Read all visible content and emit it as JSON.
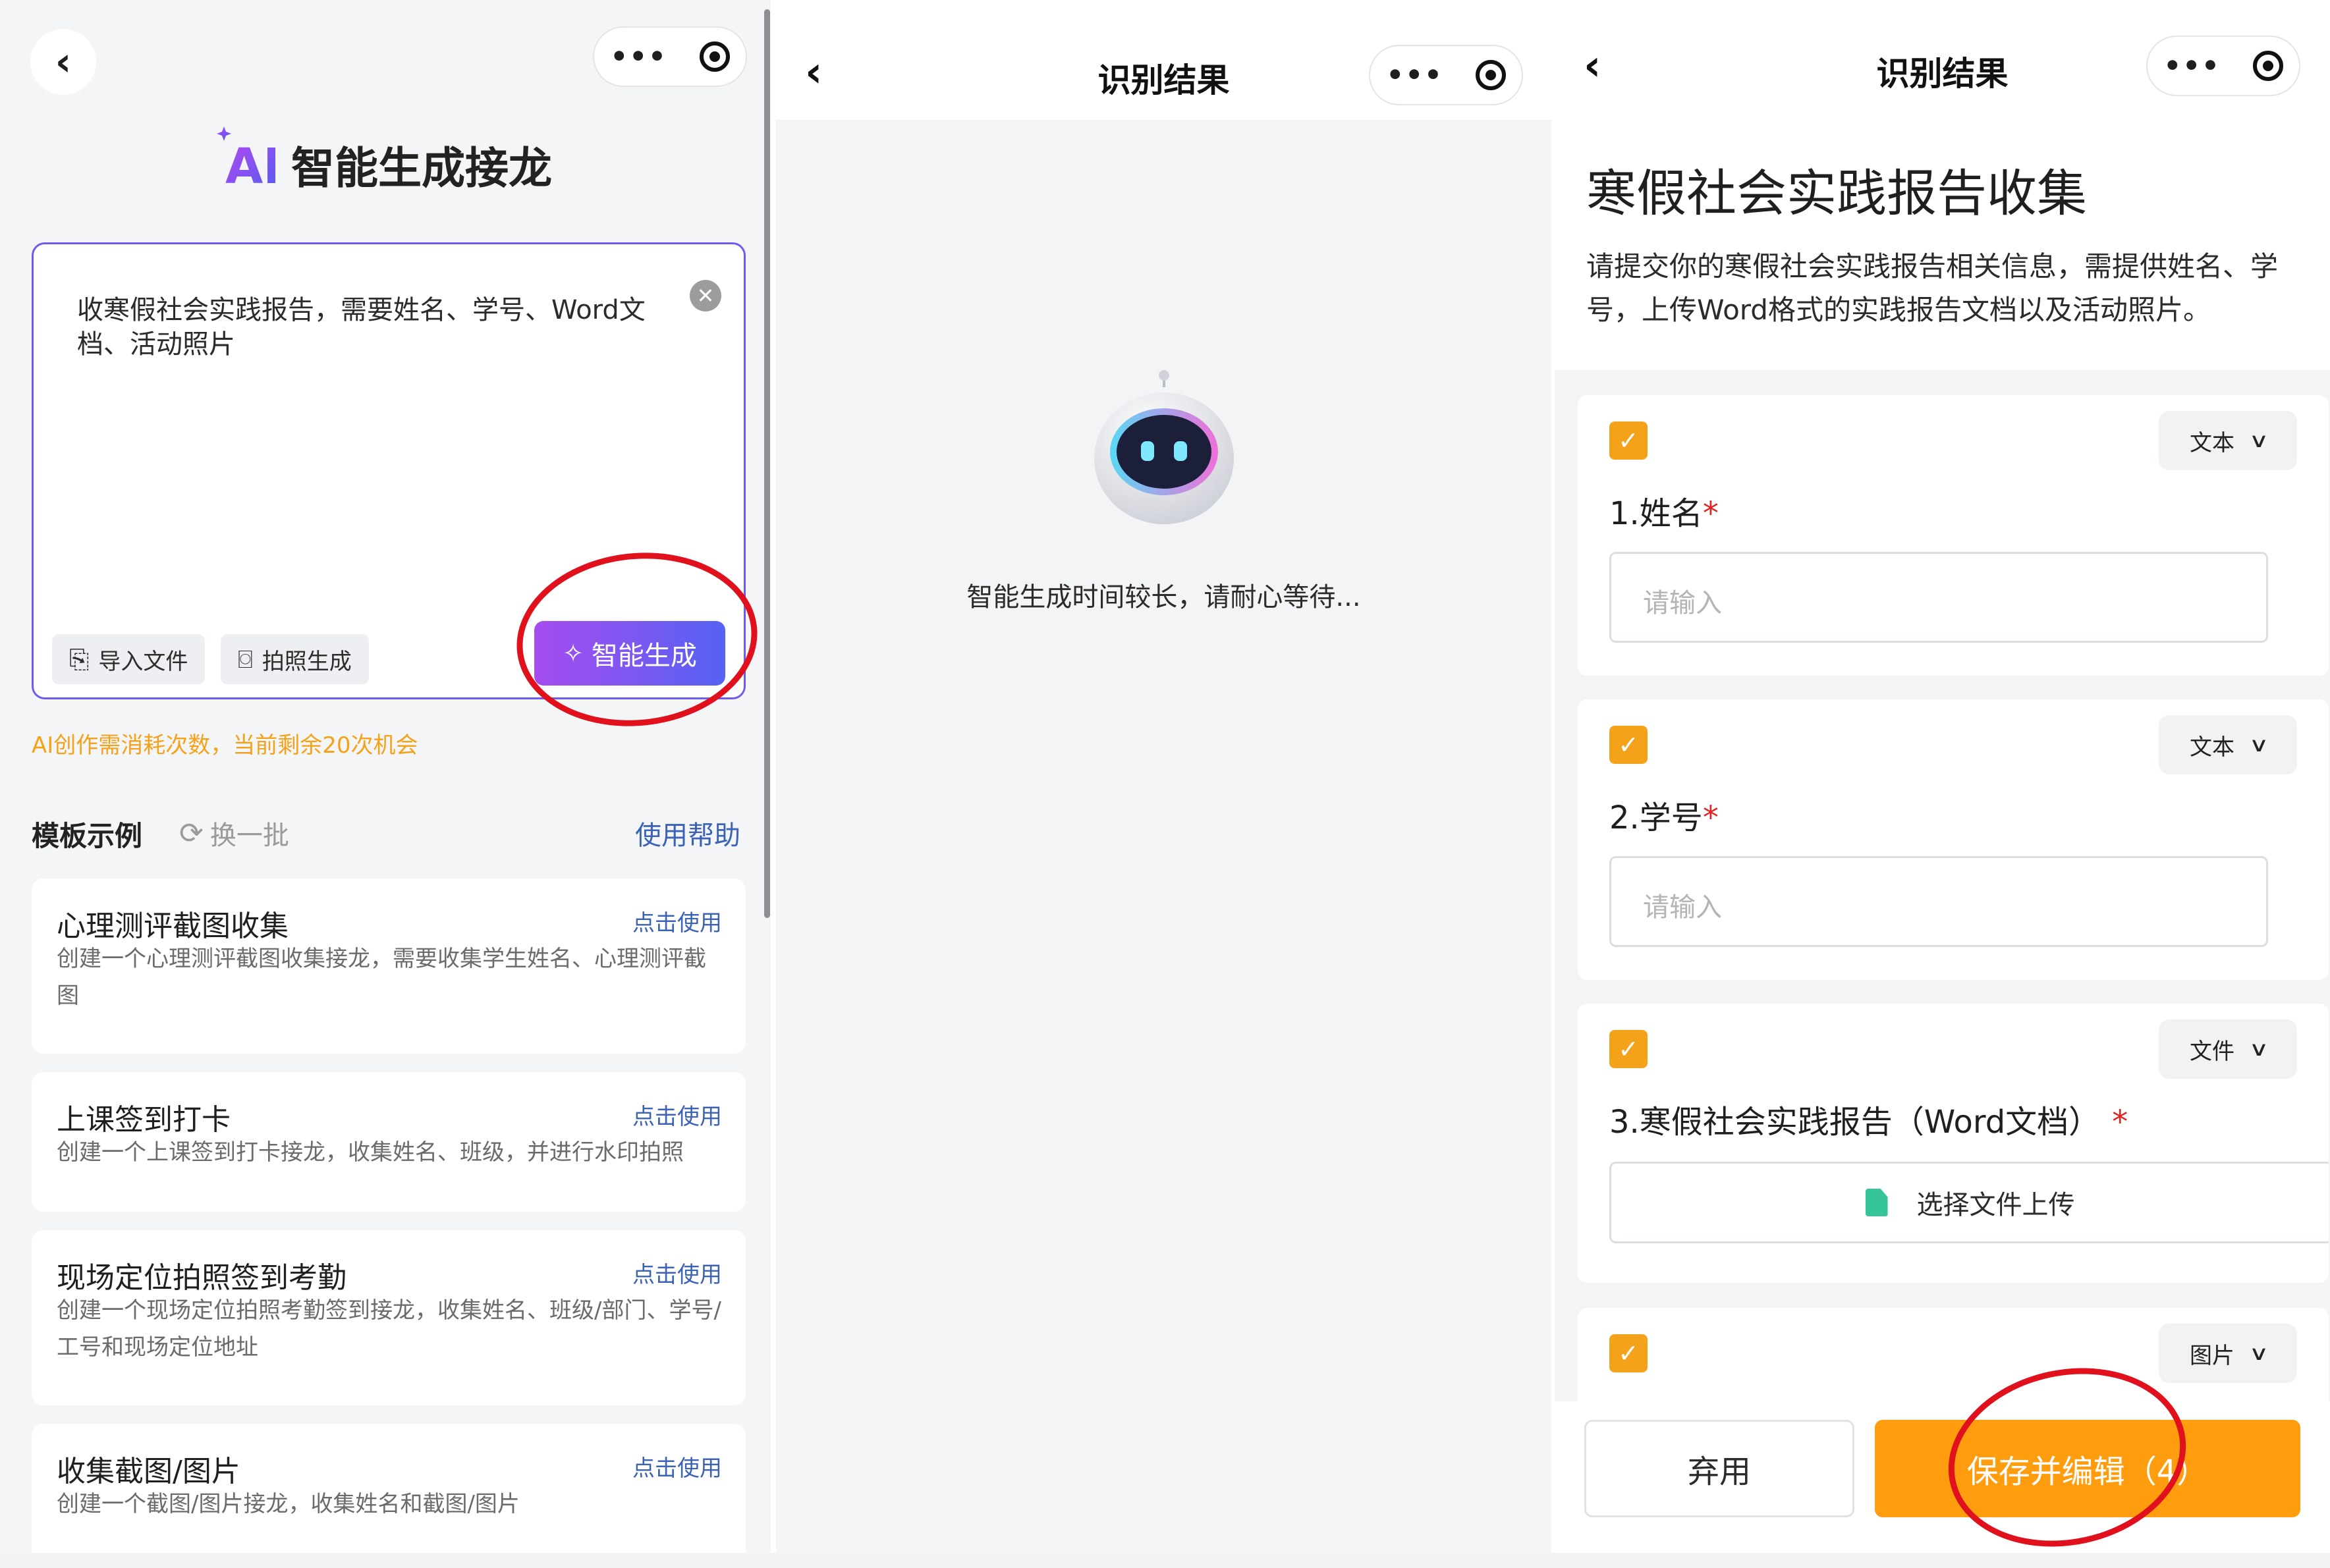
{
  "panel1": {
    "nav": {
      "more_icon": "more-dots-icon",
      "target_icon": "record-target-icon"
    },
    "ai_badge": "AI",
    "title": "智能生成接龙",
    "prompt_text": "收寒假社会实践报告，需要姓名、学号、Word文档、活动照片",
    "import_label": "导入文件",
    "photo_label": "拍照生成",
    "generate_label": "智能生成",
    "quota_text": "AI创作需消耗次数，当前剩余20次机会",
    "templates_heading": "模板示例",
    "refresh_label": "换一批",
    "help_label": "使用帮助",
    "templates": [
      {
        "title": "心理测评截图收集",
        "use": "点击使用",
        "desc": "创建一个心理测评截图收集接龙，需要收集学生姓名、心理测评截图"
      },
      {
        "title": "上课签到打卡",
        "use": "点击使用",
        "desc": "创建一个上课签到打卡接龙，收集姓名、班级，并进行水印拍照"
      },
      {
        "title": "现场定位拍照签到考勤",
        "use": "点击使用",
        "desc": "创建一个现场定位拍照考勤签到接龙，收集姓名、班级/部门、学号/工号和现场定位地址"
      },
      {
        "title": "收集截图/图片",
        "use": "点击使用",
        "desc": "创建一个截图/图片接龙，收集姓名和截图/图片"
      }
    ]
  },
  "panel2": {
    "title": "识别结果",
    "waiting_text": "智能生成时间较长，请耐心等待..."
  },
  "panel3": {
    "title": "识别结果",
    "form_title": "寒假社会实践报告收集",
    "form_desc": "请提交你的寒假社会实践报告相关信息，需提供姓名、学号，上传Word格式的实践报告文档以及活动照片。",
    "questions": [
      {
        "label": "1.姓名",
        "type": "文本",
        "placeholder": "请输入",
        "required": "*"
      },
      {
        "label": "2.学号",
        "type": "文本",
        "placeholder": "请输入",
        "required": "*"
      },
      {
        "label": "3.寒假社会实践报告（Word文档）",
        "type": "文件",
        "upload_label": "选择文件上传",
        "required": "*"
      },
      {
        "label": "",
        "type": "图片"
      }
    ],
    "discard_label": "弃用",
    "save_label": "保存并编辑（4）"
  },
  "colors": {
    "accent_orange": "#ff9d0f",
    "gradient_start": "#a64cf0",
    "gradient_end": "#5562f2",
    "annotation_red": "#e0101d",
    "link_blue": "#3b62b5"
  }
}
